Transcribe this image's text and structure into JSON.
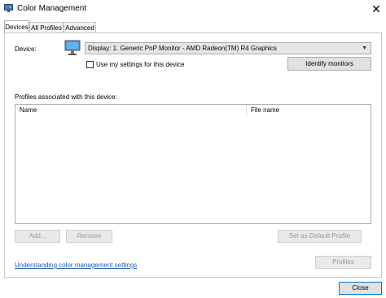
{
  "window": {
    "title": "Color Management",
    "close_glyph": "✕"
  },
  "tabs": [
    {
      "label": "Devices",
      "active": true
    },
    {
      "label": "All Profiles",
      "active": false
    },
    {
      "label": "Advanced",
      "active": false
    }
  ],
  "device": {
    "label": "Device:",
    "selected": "Display: 1. Generic PnP Monitor - AMD Radeon(TM) R4 Graphics",
    "use_my_settings_label": "Use my settings for this device",
    "use_my_settings_checked": false,
    "identify_label": "Identify monitors",
    "icon": "monitor-icon"
  },
  "profiles": {
    "section_label": "Profiles associated with this device:",
    "columns": [
      "Name",
      "File name"
    ],
    "rows": []
  },
  "buttons": {
    "add": "Add...",
    "remove": "Remove",
    "set_default": "Set as Default Profile",
    "profiles": "Profiles",
    "close": "Close"
  },
  "link": {
    "text": "Understanding color management settings"
  },
  "colors": {
    "accent": "#0078d7",
    "link": "#1e5fb4"
  }
}
